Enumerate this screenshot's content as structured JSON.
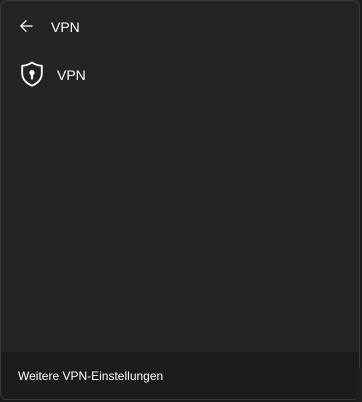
{
  "header": {
    "back_icon": "arrow-left-icon",
    "title": "VPN"
  },
  "vpn_item": {
    "icon": "shield-lock-icon",
    "label": "VPN"
  },
  "footer": {
    "link_label": "Weitere VPN-Einstellungen"
  },
  "colors": {
    "panel_background": "#242424",
    "footer_background": "#1c1c1c",
    "text": "#ffffff",
    "border": "#3a3a3a"
  }
}
